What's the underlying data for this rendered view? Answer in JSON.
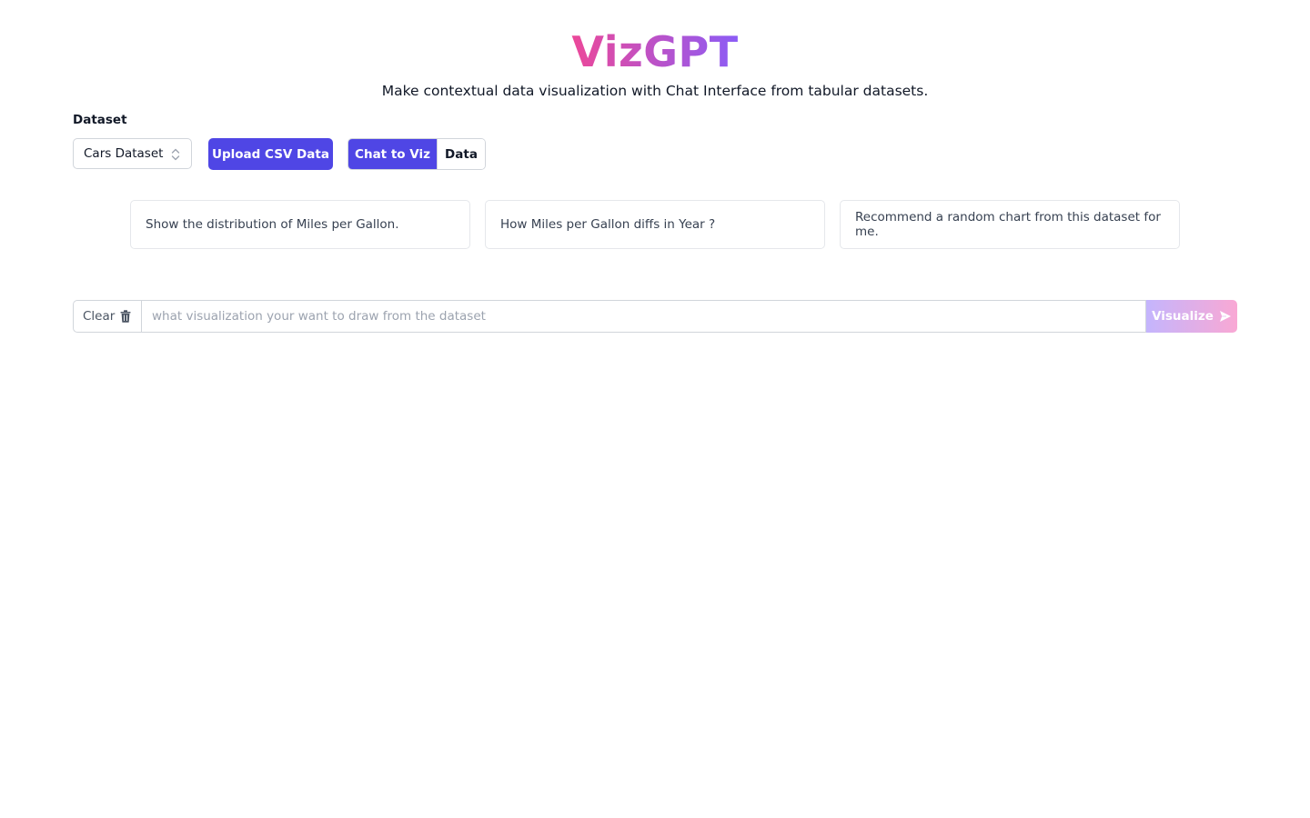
{
  "header": {
    "title": "VizGPT",
    "subtitle": "Make contextual data visualization with Chat Interface from tabular datasets."
  },
  "dataset": {
    "label": "Dataset",
    "selected": "Cars Dataset",
    "upload_label": "Upload CSV Data"
  },
  "tabs": [
    {
      "label": "Chat to Viz",
      "active": true
    },
    {
      "label": "Data",
      "active": false
    }
  ],
  "suggestions": [
    "Show the distribution of Miles per Gallon.",
    "How Miles per Gallon diffs in Year ?",
    "Recommend a random chart from this dataset for me."
  ],
  "chat_input": {
    "clear_label": "Clear",
    "placeholder": "what visualization your want to draw from the dataset",
    "value": "",
    "submit_label": "Visualize"
  },
  "icons": {
    "select": "chevron-up-down-icon",
    "clear": "trash-icon",
    "submit": "send-icon"
  },
  "colors": {
    "primary": "#4f46e5",
    "title_gradient_start": "#ec4899",
    "title_gradient_end": "#8b5cf6",
    "visualize_gradient_start": "#c4b5fd",
    "visualize_gradient_end": "#f9a8d4"
  }
}
